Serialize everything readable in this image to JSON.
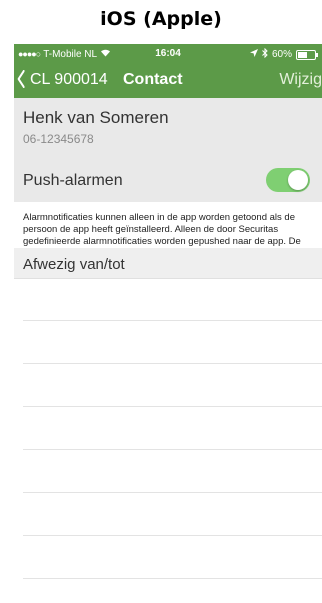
{
  "caption": "iOS (Apple)",
  "status_bar": {
    "signal_dots": "●●●●○",
    "carrier": "T-Mobile NL",
    "wifi_icon": "wifi-icon",
    "time": "16:04",
    "location_icon": "location-arrow-icon",
    "bluetooth_icon": "bluetooth-icon",
    "battery_percent": "60%",
    "battery_level": 0.6,
    "color": "#5c9a48"
  },
  "nav": {
    "back_label": "CL 900014",
    "title": "Contact",
    "edit_label": "Wijzig"
  },
  "contact": {
    "name": "Henk van Someren",
    "phone": "06-12345678",
    "push_label": "Push-alarmen",
    "push_enabled": true,
    "toggle_color": "#7fcf72"
  },
  "info": {
    "text": "Alarmnotificaties kunnen alleen in de app worden getoond als de persoon de app heeft geïnstalleerd. Alleen de door Securitas gedefinieerde alarmnotificaties worden gepushed naar de app. De overige alarmnotificaties zijn wel zichtbaar in de app na inloggen."
  },
  "absence": {
    "title": "Afwezig van/tot"
  }
}
